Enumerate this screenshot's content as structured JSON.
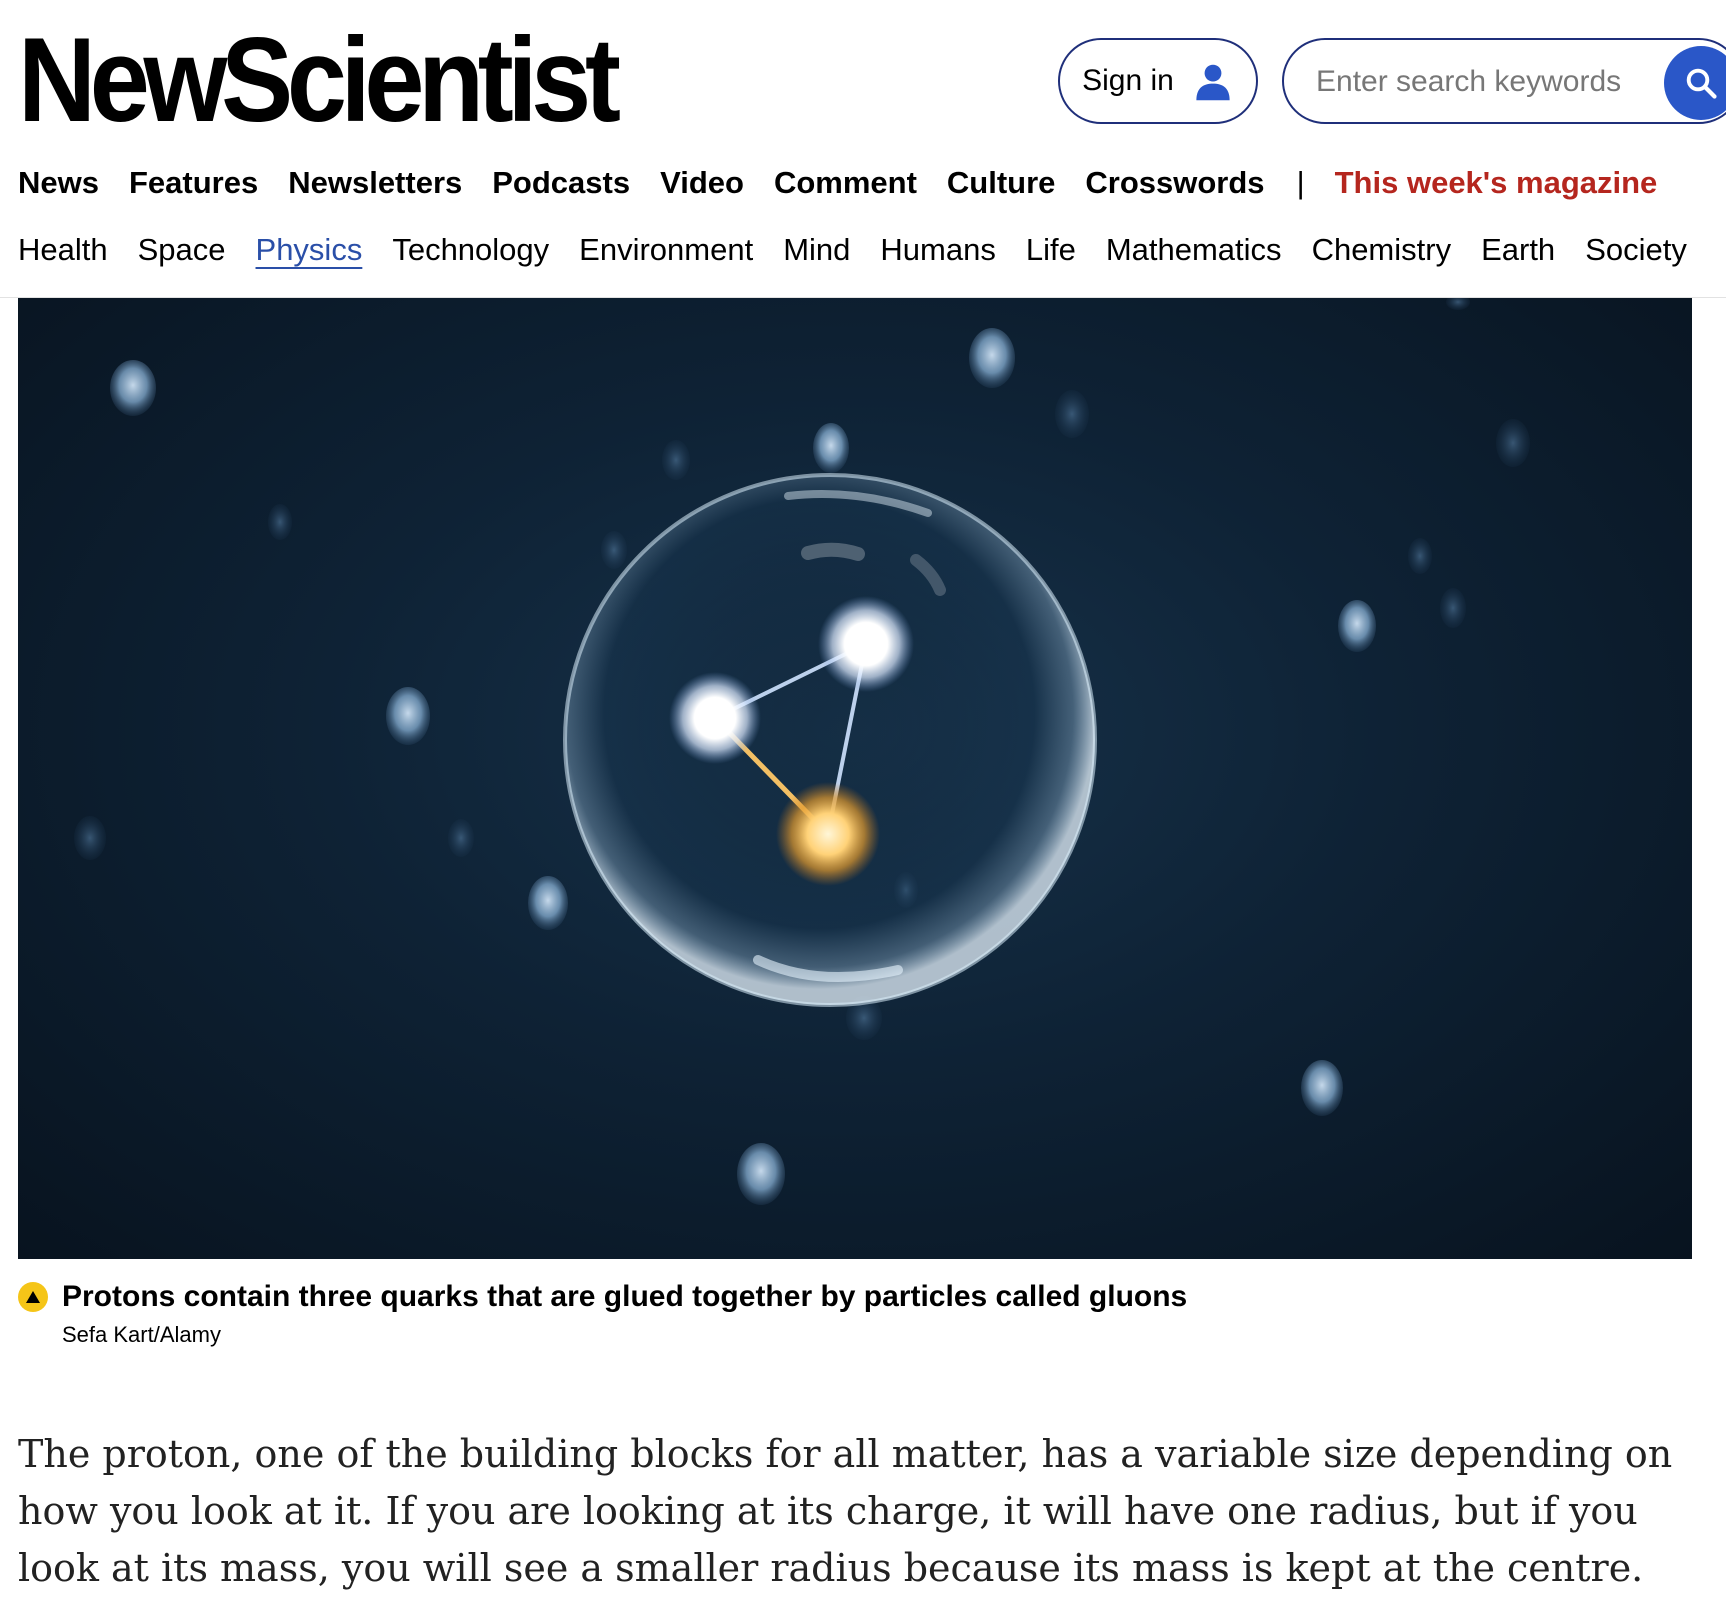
{
  "header": {
    "logo": "NewScientist",
    "sign_in_label": "Sign in",
    "search_placeholder": "Enter search keywords"
  },
  "primary_nav": {
    "items": [
      "News",
      "Features",
      "Newsletters",
      "Podcasts",
      "Video",
      "Comment",
      "Culture",
      "Crosswords"
    ],
    "separator": "|",
    "magazine_label": "This week's magazine"
  },
  "secondary_nav": {
    "items": [
      "Health",
      "Space",
      "Physics",
      "Technology",
      "Environment",
      "Mind",
      "Humans",
      "Life",
      "Mathematics",
      "Chemistry",
      "Earth",
      "Society"
    ],
    "active": "Physics"
  },
  "hero_image": {
    "caption": "Protons contain three quarks that are glued together by particles called gluons",
    "credit": "Sefa Kart/Alamy"
  },
  "article": {
    "paragraph": "The proton, one of the building blocks for all matter, has a variable size depending on how you look at it. If you are looking at its charge, it will have one radius, but if you look at its mass, you will see a smaller radius because its mass is kept at the centre."
  },
  "colors": {
    "accent_blue": "#2a57c8",
    "border_navy": "#1f2f7a",
    "magazine_red": "#b5261e",
    "active_link": "#2a4fa8",
    "caption_icon": "#f5c518"
  }
}
